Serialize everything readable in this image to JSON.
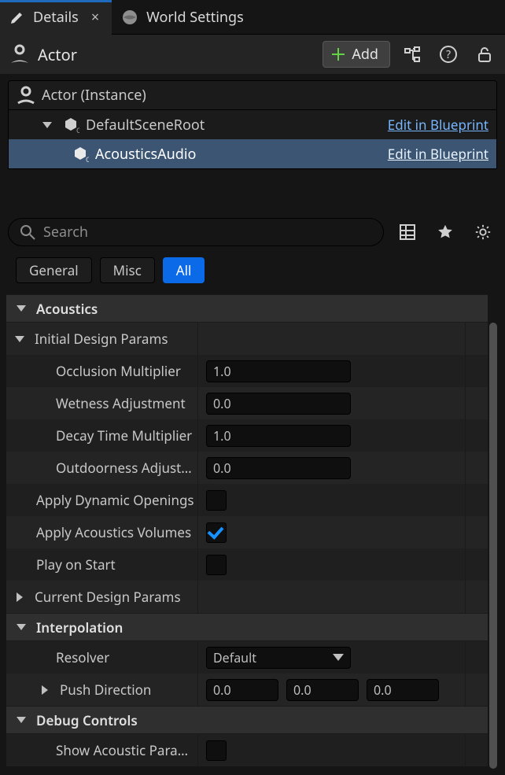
{
  "tabs": {
    "details": "Details",
    "world": "World Settings"
  },
  "title": "Actor",
  "toolbar": {
    "add_label": "Add"
  },
  "components": {
    "instance_header": "Actor (Instance)",
    "root": "DefaultSceneRoot",
    "root_link": "Edit in Blueprint",
    "child": "AcousticsAudio",
    "child_link": "Edit in Blueprint"
  },
  "search": {
    "placeholder": "Search"
  },
  "filters": {
    "general": "General",
    "misc": "Misc",
    "all": "All"
  },
  "cat_acoustics": "Acoustics",
  "cat_initial": "Initial Design Params",
  "p_occlusion": {
    "label": "Occlusion Multiplier",
    "value": "1.0"
  },
  "p_wetness": {
    "label": "Wetness Adjustment",
    "value": "0.0"
  },
  "p_decay": {
    "label": "Decay Time Multiplier",
    "value": "1.0"
  },
  "p_outdoor": {
    "label": "Outdoorness Adjustment",
    "value": "0.0"
  },
  "p_dynopen": {
    "label": "Apply Dynamic Openings",
    "value": false
  },
  "p_acvol": {
    "label": "Apply Acoustics Volumes",
    "value": true
  },
  "p_playstart": {
    "label": "Play on Start",
    "value": false
  },
  "cat_current": "Current Design Params",
  "cat_interp": "Interpolation",
  "p_resolver": {
    "label": "Resolver",
    "value": "Default"
  },
  "p_pushdir": {
    "label": "Push Direction",
    "x": "0.0",
    "y": "0.0",
    "z": "0.0"
  },
  "cat_debug": "Debug Controls",
  "p_showparam": {
    "label": "Show Acoustic Paramet…",
    "value": false
  }
}
